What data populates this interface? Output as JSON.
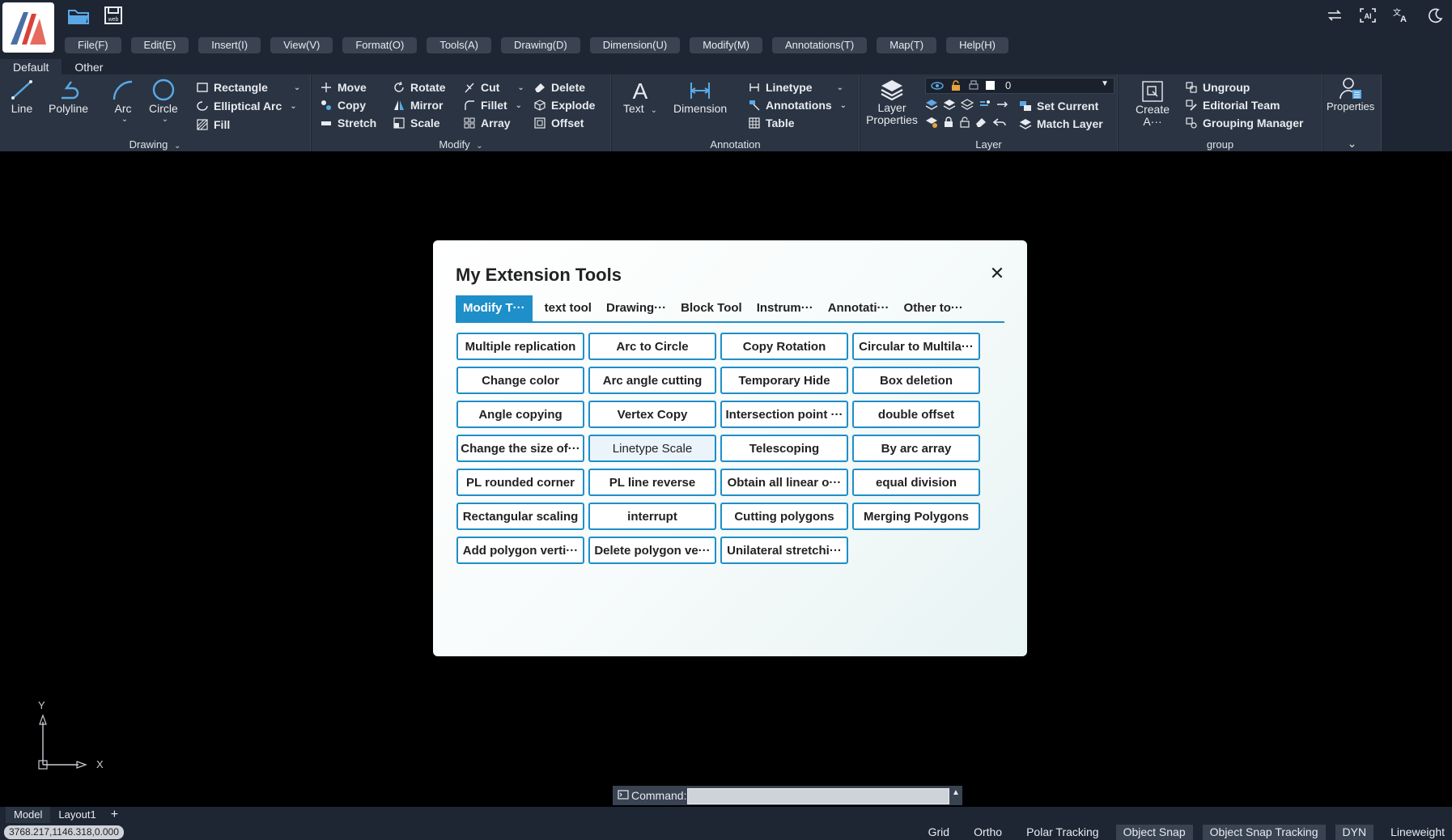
{
  "app": {
    "logo": "app-logo"
  },
  "menu": [
    "File(F)",
    "Edit(E)",
    "Insert(I)",
    "View(V)",
    "Format(O)",
    "Tools(A)",
    "Drawing(D)",
    "Dimension(U)",
    "Modify(M)",
    "Annotations(T)",
    "Map(T)",
    "Help(H)"
  ],
  "ribbon_tabs": [
    "Default",
    "Other"
  ],
  "ribbon": {
    "drawing": {
      "title": "Drawing",
      "line": "Line",
      "polyline": "Polyline",
      "arc": "Arc",
      "circle": "Circle",
      "rectangle": "Rectangle",
      "elliptical_arc": "Elliptical Arc",
      "fill": "Fill"
    },
    "modify": {
      "title": "Modify",
      "move": "Move",
      "copy": "Copy",
      "stretch": "Stretch",
      "rotate": "Rotate",
      "mirror": "Mirror",
      "scale": "Scale",
      "cut": "Cut",
      "fillet": "Fillet",
      "array": "Array",
      "delete": "Delete",
      "explode": "Explode",
      "offset": "Offset"
    },
    "annotation": {
      "title": "Annotation",
      "text": "Text",
      "dimension": "Dimension",
      "linetype": "Linetype",
      "annotations": "Annotations",
      "table": "Table"
    },
    "layer": {
      "title": "Layer",
      "layer_properties": "Layer Properties",
      "current_layer": "0",
      "set_current": "Set Current",
      "match_layer": "Match Layer"
    },
    "group": {
      "title": "group",
      "create": "Create A···",
      "ungroup": "Ungroup",
      "editorial_team": "Editorial Team",
      "grouping_manager": "Grouping Manager"
    },
    "properties": {
      "label": "Properties"
    }
  },
  "dialog": {
    "title": "My Extension Tools",
    "close": "✕",
    "tabs": [
      "Modify T···",
      "text tool",
      "Drawing···",
      "Block Tool",
      "Instrum···",
      "Annotati···",
      "Other to···"
    ],
    "buttons": [
      "Multiple replication",
      "Arc to Circle",
      "Copy Rotation",
      "Circular to Multila···",
      "Change color",
      "Arc angle cutting",
      "Temporary Hide",
      "Box deletion",
      "Angle copying",
      "Vertex Copy",
      "Intersection point ···",
      "double offset",
      "Change the size of···",
      "Linetype Scale",
      "Telescoping",
      "By arc array",
      "PL rounded corner",
      "PL line reverse",
      "Obtain all linear o···",
      "equal division",
      "Rectangular scaling",
      "interrupt",
      "Cutting polygons",
      "Merging Polygons",
      "Add polygon verti···",
      "Delete polygon ve···",
      "Unilateral stretchi···"
    ]
  },
  "ucs": {
    "x": "X",
    "y": "Y"
  },
  "command": {
    "label": "Command:"
  },
  "layout_tabs": [
    "Model",
    "Layout1",
    "+"
  ],
  "status": {
    "coords": "3768.217,1146.318,0.000",
    "toggles": [
      "Grid",
      "Ortho",
      "Polar Tracking",
      "Object Snap",
      "Object Snap Tracking",
      "DYN",
      "Lineweight"
    ]
  },
  "colors": {
    "accent": "#1e8fc8",
    "topbar": "#1e2633",
    "panel": "#2b3442"
  }
}
